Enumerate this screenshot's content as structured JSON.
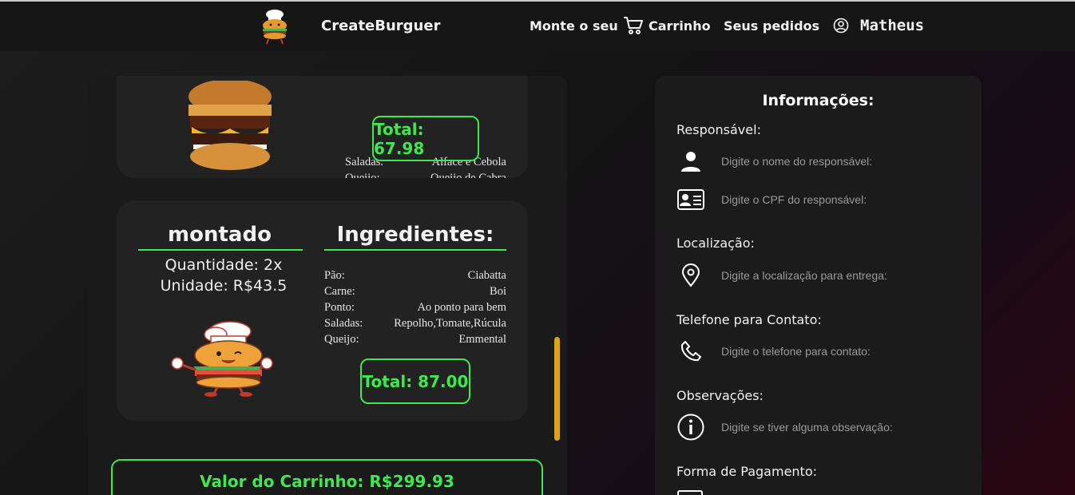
{
  "header": {
    "brand": "CreateBurguer",
    "nav": [
      "Monte o seu",
      "Carrinho",
      "Seus pedidos"
    ],
    "user": "Matheus"
  },
  "cart": {
    "items": [
      {
        "ingredients": [
          {
            "label": "Saladas:",
            "value": "Alface e Cebola"
          },
          {
            "label": "Queijo:",
            "value": "Queijo de Cabra"
          }
        ],
        "total": "Total: 67.98"
      },
      {
        "name": "montado",
        "quantity": "Quantidade: 2x",
        "unit": "Unidade: R$43.5",
        "ingredients_title": "Ingredientes:",
        "ingredients": [
          {
            "label": "Pão:",
            "value": "Ciabatta"
          },
          {
            "label": "Carne:",
            "value": "Boi"
          },
          {
            "label": "Ponto:",
            "value": "Ao ponto para bem"
          },
          {
            "label": "Saladas:",
            "value": "Repolho,Tomate,Rúcula"
          },
          {
            "label": "Queijo:",
            "value": "Emmental"
          }
        ],
        "total": "Total: 87.00"
      }
    ],
    "cart_value": "Valor do Carrinho: R$299.93"
  },
  "info": {
    "title": "Informações:",
    "sections": {
      "responsavel": "Responsável:",
      "localizacao": "Localização:",
      "telefone": "Telefone para Contato:",
      "observacoes": "Observações:",
      "pagamento": "Forma de Pagamento:"
    },
    "placeholders": {
      "nome": "Digite o nome do responsável:",
      "cpf": "Digite o CPF do responsável:",
      "local": "Digite a localização para entrega:",
      "telefone": "Digite o telefone para contato:",
      "obs": "Digite se tiver alguma observação:"
    }
  },
  "colors": {
    "accent_green": "#3fe84e",
    "scrollbar": "#d9a520",
    "panel": "#1a1a1a",
    "card": "#222222"
  }
}
